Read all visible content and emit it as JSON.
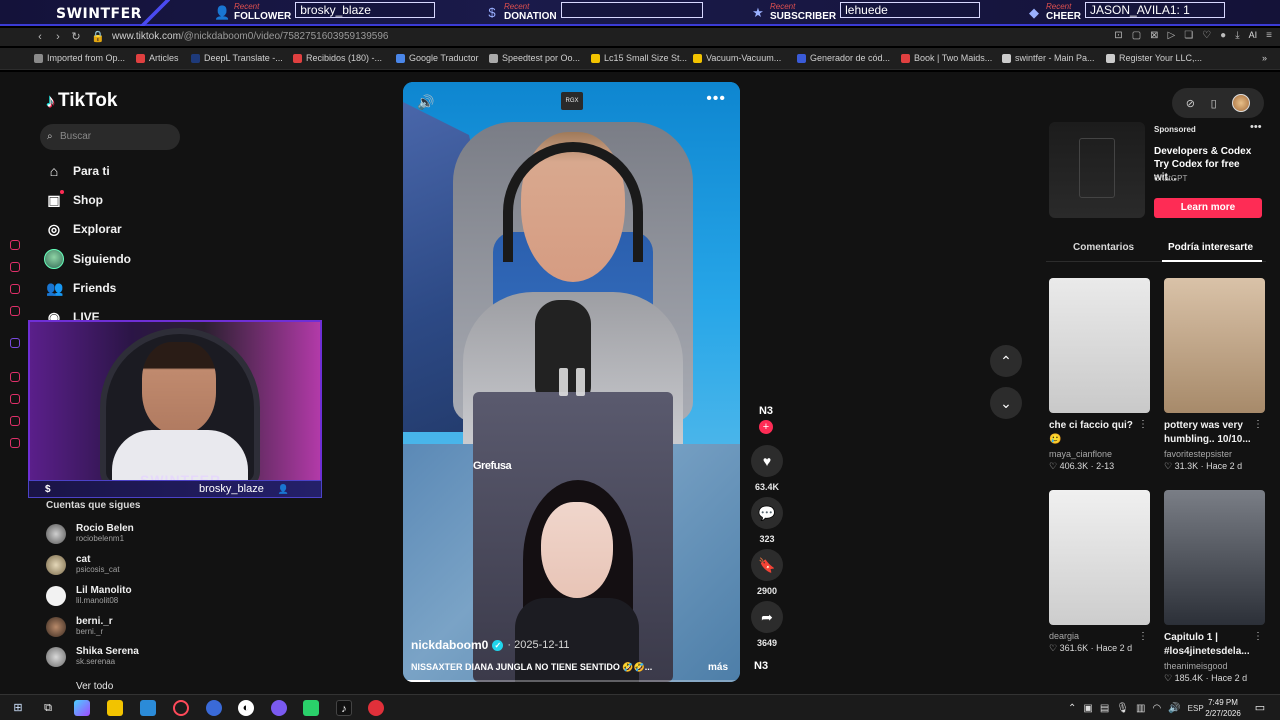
{
  "overlay": {
    "brand": "SWINTFER",
    "recent_label": "Recent",
    "items": [
      {
        "type": "FOLLOWER",
        "value": "brosky_blaze",
        "icon": "user-icon"
      },
      {
        "type": "DONATION",
        "value": "",
        "icon": "dollar-icon"
      },
      {
        "type": "SUBSCRIBER",
        "value": "lehuede",
        "icon": "star-icon"
      },
      {
        "type": "CHEER",
        "value": "JASON_AVILA1: 1",
        "icon": "diamond-icon"
      }
    ]
  },
  "browser": {
    "url_host": "www.tiktok.com",
    "url_path": "/@nickdaboom0/video/7582751603959139596",
    "ai_label": "AI",
    "bookmarks": [
      {
        "label": "Imported from Op...",
        "color": "#8a8a8a"
      },
      {
        "label": "Articles",
        "color": "#e04040"
      },
      {
        "label": "DeepL Translate -...",
        "color": "#1e3a7a"
      },
      {
        "label": "Recibidos (180) -...",
        "color": "#e04040"
      },
      {
        "label": "Google Traductor",
        "color": "#4a86e8"
      },
      {
        "label": "Speedtest por Oo...",
        "color": "#aaaaaa"
      },
      {
        "label": "Lc15 Small Size St...",
        "color": "#f2c300"
      },
      {
        "label": "Vacuum-Vacuum...",
        "color": "#f2c300"
      },
      {
        "label": "Generador de cód...",
        "color": "#3a5bd8"
      },
      {
        "label": "Book | Two Maids...",
        "color": "#e04040"
      },
      {
        "label": "swintfer - Main Pa...",
        "color": "#cccccc"
      },
      {
        "label": "Register Your LLC,...",
        "color": "#cccccc"
      }
    ]
  },
  "sidebar": {
    "logo": "TikTok",
    "search_placeholder": "Buscar",
    "nav": [
      {
        "label": "Para ti",
        "icon": "home-icon"
      },
      {
        "label": "Shop",
        "icon": "shop-icon"
      },
      {
        "label": "Explorar",
        "icon": "compass-icon"
      },
      {
        "label": "Siguiendo",
        "icon": "avatar"
      },
      {
        "label": "Friends",
        "icon": "friends-icon"
      },
      {
        "label": "LIVE",
        "icon": "live-icon"
      }
    ],
    "following_title": "Cuentas que sigues",
    "accounts": [
      {
        "name": "Rocio Belen",
        "handle": "rociobelenm1"
      },
      {
        "name": "cat",
        "handle": "psicosis_cat"
      },
      {
        "name": "Lil Manolito",
        "handle": "lil.manolit08"
      },
      {
        "name": "berni._r",
        "handle": "berni._r"
      },
      {
        "name": "Shika Serena",
        "handle": "sk.serenaa"
      }
    ],
    "see_all": "Ver todo"
  },
  "webcam": {
    "brand": "SWINTFER",
    "username": "brosky_blaze"
  },
  "video": {
    "rgx": "RGX",
    "sponsor": "Grefusa",
    "author": "nickdaboom0",
    "date": "2025-12-11",
    "caption": "NISSAXTER DIANA JUNGLA NO TIENE SENTIDO 🤣🤣...",
    "more": "más",
    "progress": 0.08
  },
  "actions": {
    "avatar_label": "N3",
    "likes": "63.4K",
    "comments": "323",
    "saves": "2900",
    "shares": "3649",
    "music_label": "N3"
  },
  "ad": {
    "sponsored": "Sponsored",
    "title": "Developers & Codex ⁣ Try Codex for free wit...",
    "source": "ChatGPT",
    "cta": "Learn more"
  },
  "tabs": [
    "Comentarios",
    "Podría interesarte"
  ],
  "cards": [
    {
      "title": "che ci faccio qui? 🥲",
      "author": "maya_cianflone",
      "likes": "406.3K",
      "age": "2-13"
    },
    {
      "title": "pottery was very humbling.. 10/10...",
      "author": "favoritestepsister",
      "likes": "31.3K",
      "age": "Hace 2 d"
    },
    {
      "title": "",
      "author": "deargia",
      "likes": "361.6K",
      "age": "Hace 2 d"
    },
    {
      "title": "Capitulo 1 | #los4jinetesdela...",
      "author": "theanimeisgood",
      "likes": "185.4K",
      "age": "Hace 2 d"
    }
  ],
  "taskbar": {
    "lang": "ESP",
    "time": "7:49 PM",
    "date": "2/27/2026"
  }
}
